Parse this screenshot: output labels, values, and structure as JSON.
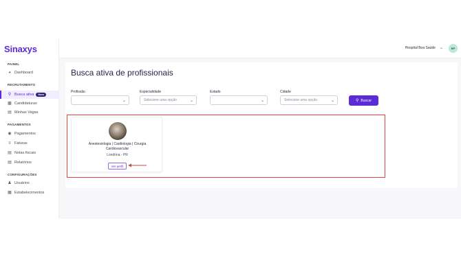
{
  "app": {
    "logo": "Sinaxys"
  },
  "sidebar": {
    "sections": [
      {
        "label": "PAINEL"
      },
      {
        "label": "RECRUTAMENTO"
      },
      {
        "label": "PAGAMENTOS"
      },
      {
        "label": "CONFIGURAÇÕES"
      }
    ],
    "items": [
      {
        "label": "Dashboard",
        "icon": "dashboard-icon"
      },
      {
        "label": "Busca ativa",
        "icon": "search-icon",
        "badge": "Novo",
        "active": true
      },
      {
        "label": "Candidaturas",
        "icon": "users-icon"
      },
      {
        "label": "Minhas Vagas",
        "icon": "briefcase-icon"
      },
      {
        "label": "Pagamentos",
        "icon": "money-icon"
      },
      {
        "label": "Faturas",
        "icon": "invoice-icon"
      },
      {
        "label": "Notas fiscais",
        "icon": "receipt-icon"
      },
      {
        "label": "Relatórios",
        "icon": "report-icon"
      },
      {
        "label": "Usuários",
        "icon": "user-icon"
      },
      {
        "label": "Estabelecimentos",
        "icon": "building-icon"
      }
    ]
  },
  "topbar": {
    "org": "Hospital Boa Saúde",
    "avatar_initials": "BP"
  },
  "main": {
    "title": "Busca ativa de profissionais",
    "filters": [
      {
        "label": "Profissão",
        "value": ""
      },
      {
        "label": "Especialidade",
        "placeholder": "Selecione uma opção"
      },
      {
        "label": "Estado",
        "value": ""
      },
      {
        "label": "Cidade",
        "placeholder": "Selecione uma opção"
      }
    ],
    "search_button": "Buscar",
    "results": [
      {
        "specialties": "Anestesiologia | Cardiologia | Cirurgia Cardiovascular",
        "location": "Londrina - PR",
        "profile_button": "Ver perfil"
      }
    ]
  },
  "colors": {
    "accent": "#5a2bd6",
    "highlight": "#e2433a",
    "badge": "#2b2270"
  }
}
